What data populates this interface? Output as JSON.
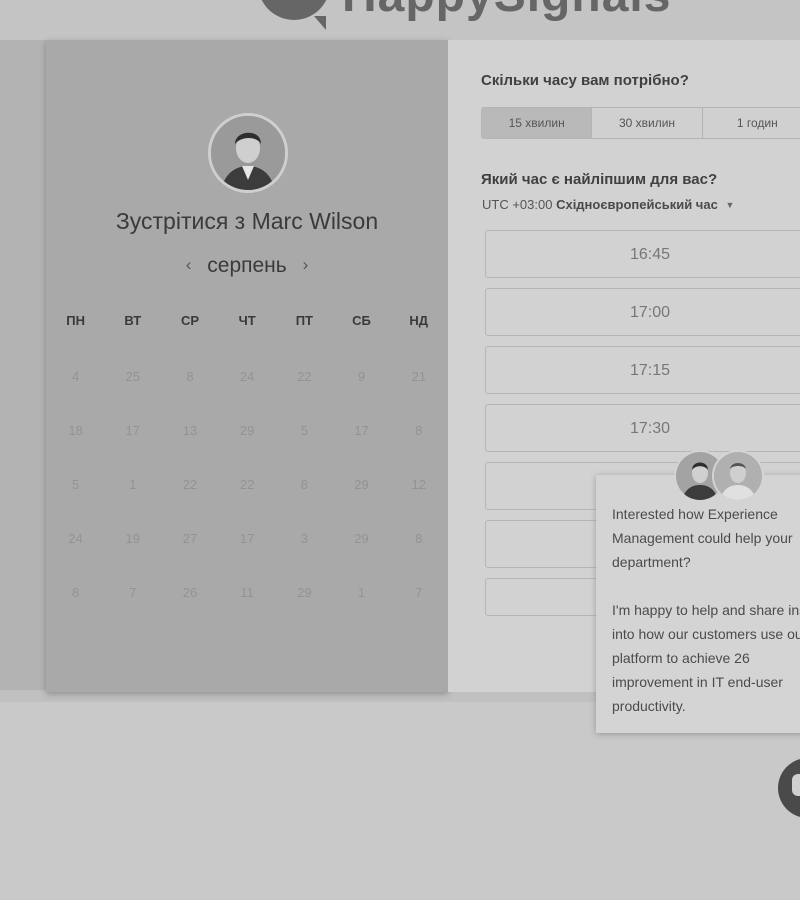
{
  "brand": {
    "logo_text": "HappySignals"
  },
  "left": {
    "title": "Зустрітися з Marc Wilson",
    "month": "серпень",
    "weekdays": [
      "ПН",
      "ВТ",
      "СР",
      "ЧТ",
      "ПТ",
      "СБ",
      "НД"
    ],
    "weeks": [
      [
        "4",
        "25",
        "8",
        "24",
        "22",
        "9",
        "21"
      ],
      [
        "18",
        "17",
        "13",
        "29",
        "5",
        "17",
        "8"
      ],
      [
        "5",
        "1",
        "22",
        "22",
        "8",
        "29",
        "12"
      ],
      [
        "24",
        "19",
        "27",
        "17",
        "3",
        "29",
        "8"
      ],
      [
        "8",
        "7",
        "26",
        "11",
        "29",
        "1",
        "7"
      ]
    ]
  },
  "right": {
    "duration_question": "Скільки часу вам потрібно?",
    "durations": [
      "15 хвилин",
      "30 хвилин",
      "1 годин"
    ],
    "selected_duration": "15 хвилин",
    "time_question": "Який час є найліпшим для вас?",
    "timezone_offset": "UTC +03:00",
    "timezone_name": "Східноєвропейський час",
    "slots": [
      "16:45",
      "17:00",
      "17:15",
      "17:30",
      "",
      "",
      ""
    ]
  },
  "chat": {
    "message": "Interested how Experience Management could help your department?\n\nI'm happy to help and share insight into how our customers use our platform to achieve 26 improvement in IT end-user productivity."
  }
}
